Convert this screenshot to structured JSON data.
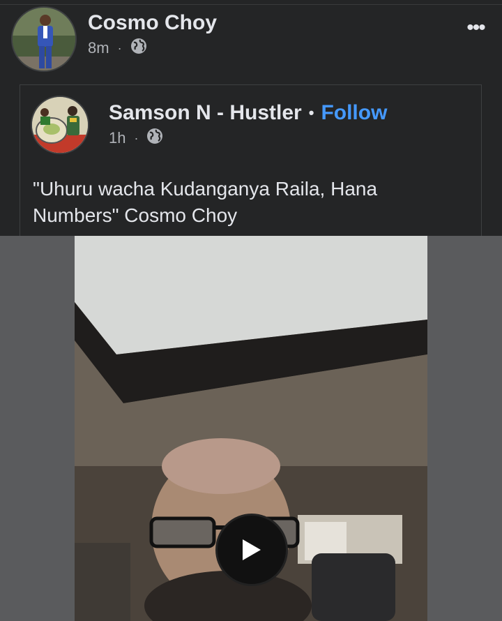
{
  "post": {
    "author": "Cosmo Choy",
    "time": "8m",
    "separator": "·",
    "privacy_icon": "globe-icon",
    "more_icon": "more-options-icon",
    "more_label": "•••"
  },
  "shared_post": {
    "author": "Samson N - Hustler",
    "bullet": "•",
    "follow_label": "Follow",
    "time": "1h",
    "separator": "·",
    "privacy_icon": "globe-icon",
    "text": "\"Uhuru wacha Kudanganya Raila, Hana Numbers\" Cosmo Choy"
  },
  "video": {
    "play_icon": "play-icon"
  },
  "colors": {
    "background": "#242526",
    "text_primary": "#e4e6eb",
    "text_secondary": "#b0b3b8",
    "link": "#4599ff",
    "divider": "#3e4042"
  }
}
